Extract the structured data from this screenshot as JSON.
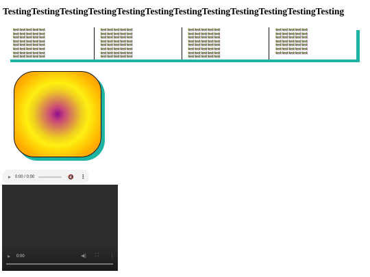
{
  "page": {
    "title": "TestingTestingTestingTestingTestingTestingTestingTestingTestingTestingTestingTesting"
  },
  "columns": {
    "word": "test",
    "rows_per_column": [
      8,
      8,
      8,
      7
    ],
    "words_per_row": 5
  },
  "audio_player": {
    "time_label": "0:00 / 0:00",
    "volume_icon": "volume-icon",
    "more_icon": "more-options-icon"
  },
  "video_player": {
    "time_label": "0:00"
  },
  "colors": {
    "shadow_accent": "#1fb3a4",
    "gradient_center": "#8e0f8e",
    "gradient_mid": "#ffef10",
    "gradient_outer": "#ff8a00"
  }
}
